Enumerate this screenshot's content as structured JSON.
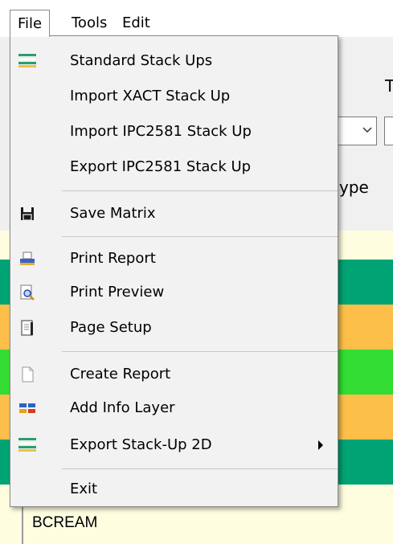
{
  "menubar": {
    "items": [
      {
        "label": "File"
      },
      {
        "label": "Tools"
      },
      {
        "label": "Edit"
      }
    ]
  },
  "file_menu": {
    "items": [
      {
        "label": "Standard Stack Ups",
        "icon": "stack-layers-icon"
      },
      {
        "label": "Import XACT Stack Up"
      },
      {
        "label": "Import IPC2581 Stack Up"
      },
      {
        "label": "Export IPC2581 Stack Up"
      },
      {
        "label": "Save Matrix",
        "icon": "floppy-disk-icon"
      },
      {
        "label": "Print Report",
        "icon": "printer-icon"
      },
      {
        "label": "Print Preview",
        "icon": "print-preview-icon"
      },
      {
        "label": "Page Setup",
        "icon": "page-setup-icon"
      },
      {
        "label": "Create Report",
        "icon": "blank-document-icon"
      },
      {
        "label": "Add Info Layer",
        "icon": "info-layer-icon"
      },
      {
        "label": "Export Stack-Up 2D",
        "icon": "stack-layers-icon",
        "has_submenu": true
      },
      {
        "label": "Exit"
      }
    ]
  },
  "background": {
    "partial_title": "T",
    "type_header": "ype",
    "table_bottom_label": "BCREAM",
    "band_colors": [
      "#fefde0",
      "#00a374",
      "#fbbf4a",
      "#33dd33",
      "#fbbf4a",
      "#00a374",
      "#fefde0"
    ]
  }
}
